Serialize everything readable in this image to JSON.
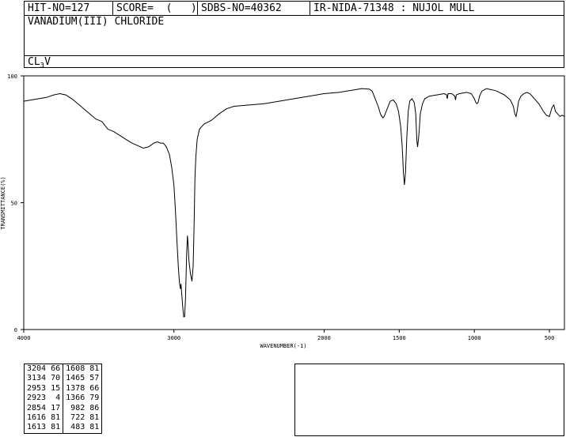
{
  "header": {
    "hit_no": "HIT-NO=127",
    "score": "SCORE=  (   )",
    "sdbs_no": "SDBS-NO=40362",
    "ir_nida": "IR-NIDA-71348 : NUJOL MULL"
  },
  "compound": {
    "name": "VANADIUM(III) CHLORIDE",
    "formula_prefix": "CL",
    "formula_sub": "3",
    "formula_suffix": "V"
  },
  "chart_data": {
    "type": "line",
    "xlabel": "WAVENUMBER(-1)",
    "ylabel": "TRANSMITTANCE(%)",
    "xlim": [
      4000,
      400
    ],
    "ylim": [
      0,
      100
    ],
    "x_ticks": [
      4000,
      3000,
      2000,
      1500,
      1000,
      500
    ],
    "y_ticks": [
      0,
      50,
      100
    ],
    "grid": false,
    "series": [
      {
        "color": "#000000",
        "points": [
          [
            4000,
            90
          ],
          [
            3950,
            90.5
          ],
          [
            3900,
            91
          ],
          [
            3850,
            91.5
          ],
          [
            3800,
            92.5
          ],
          [
            3760,
            93
          ],
          [
            3720,
            92.5
          ],
          [
            3680,
            91
          ],
          [
            3640,
            89
          ],
          [
            3600,
            87
          ],
          [
            3560,
            85
          ],
          [
            3520,
            83
          ],
          [
            3480,
            82
          ],
          [
            3440,
            79
          ],
          [
            3400,
            78
          ],
          [
            3360,
            76.5
          ],
          [
            3320,
            75
          ],
          [
            3280,
            73.5
          ],
          [
            3240,
            72.5
          ],
          [
            3204,
            71.5
          ],
          [
            3170,
            72
          ],
          [
            3134,
            73.5
          ],
          [
            3110,
            74
          ],
          [
            3090,
            73.5
          ],
          [
            3070,
            73.5
          ],
          [
            3050,
            72
          ],
          [
            3030,
            69
          ],
          [
            3015,
            64
          ],
          [
            3000,
            57
          ],
          [
            2990,
            47
          ],
          [
            2980,
            35
          ],
          [
            2970,
            24
          ],
          [
            2962,
            18
          ],
          [
            2957,
            16
          ],
          [
            2953,
            18
          ],
          [
            2948,
            14
          ],
          [
            2940,
            8
          ],
          [
            2935,
            5
          ],
          [
            2929,
            5
          ],
          [
            2923,
            12
          ],
          [
            2915,
            30
          ],
          [
            2910,
            37
          ],
          [
            2905,
            33
          ],
          [
            2900,
            27
          ],
          [
            2890,
            22
          ],
          [
            2880,
            19
          ],
          [
            2872,
            25
          ],
          [
            2866,
            40
          ],
          [
            2860,
            60
          ],
          [
            2854,
            68
          ],
          [
            2845,
            75
          ],
          [
            2830,
            79
          ],
          [
            2800,
            81
          ],
          [
            2750,
            82.5
          ],
          [
            2700,
            85
          ],
          [
            2650,
            87
          ],
          [
            2600,
            88
          ],
          [
            2500,
            88.5
          ],
          [
            2400,
            89
          ],
          [
            2300,
            90
          ],
          [
            2200,
            91
          ],
          [
            2100,
            92
          ],
          [
            2000,
            93
          ],
          [
            1900,
            93.5
          ],
          [
            1850,
            94
          ],
          [
            1800,
            94.5
          ],
          [
            1750,
            95
          ],
          [
            1700,
            94.8
          ],
          [
            1680,
            94
          ],
          [
            1660,
            91
          ],
          [
            1640,
            88
          ],
          [
            1625,
            85
          ],
          [
            1616,
            84
          ],
          [
            1608,
            83.5
          ],
          [
            1600,
            84
          ],
          [
            1580,
            87
          ],
          [
            1560,
            90
          ],
          [
            1540,
            90.5
          ],
          [
            1520,
            89
          ],
          [
            1505,
            86
          ],
          [
            1490,
            80
          ],
          [
            1480,
            72
          ],
          [
            1472,
            62
          ],
          [
            1465,
            57
          ],
          [
            1458,
            62
          ],
          [
            1450,
            75
          ],
          [
            1440,
            86
          ],
          [
            1430,
            90
          ],
          [
            1415,
            91
          ],
          [
            1400,
            89.5
          ],
          [
            1390,
            85
          ],
          [
            1383,
            75
          ],
          [
            1378,
            72
          ],
          [
            1372,
            75
          ],
          [
            1366,
            79
          ],
          [
            1360,
            85
          ],
          [
            1345,
            89
          ],
          [
            1330,
            91
          ],
          [
            1300,
            92
          ],
          [
            1250,
            92.5
          ],
          [
            1200,
            93
          ],
          [
            1185,
            92.5
          ],
          [
            1180,
            91
          ],
          [
            1175,
            93
          ],
          [
            1150,
            93
          ],
          [
            1130,
            92
          ],
          [
            1125,
            90.5
          ],
          [
            1120,
            92.5
          ],
          [
            1100,
            93
          ],
          [
            1050,
            93.5
          ],
          [
            1020,
            93
          ],
          [
            1000,
            91
          ],
          [
            990,
            89.5
          ],
          [
            982,
            89
          ],
          [
            975,
            89.5
          ],
          [
            965,
            92
          ],
          [
            950,
            94
          ],
          [
            920,
            95
          ],
          [
            880,
            94.5
          ],
          [
            850,
            94
          ],
          [
            800,
            92.5
          ],
          [
            760,
            90.5
          ],
          [
            740,
            88
          ],
          [
            730,
            85
          ],
          [
            722,
            84
          ],
          [
            715,
            86
          ],
          [
            705,
            90
          ],
          [
            690,
            92
          ],
          [
            670,
            93
          ],
          [
            650,
            93.5
          ],
          [
            630,
            93
          ],
          [
            600,
            91
          ],
          [
            570,
            89
          ],
          [
            540,
            86
          ],
          [
            520,
            84.5
          ],
          [
            500,
            84
          ],
          [
            490,
            86
          ],
          [
            483,
            87.5
          ],
          [
            470,
            88.5
          ],
          [
            460,
            86
          ],
          [
            445,
            85
          ],
          [
            430,
            84
          ],
          [
            415,
            84.5
          ],
          [
            400,
            84
          ]
        ]
      }
    ]
  },
  "peaks": [
    [
      [
        "3204",
        "66"
      ],
      [
        "1608",
        "81"
      ]
    ],
    [
      [
        "3134",
        "70"
      ],
      [
        "1465",
        "57"
      ]
    ],
    [
      [
        "2953",
        "15"
      ],
      [
        "1378",
        "66"
      ]
    ],
    [
      [
        "2923",
        "4"
      ],
      [
        "1366",
        "79"
      ]
    ],
    [
      [
        "2854",
        "17"
      ],
      [
        "982",
        "86"
      ]
    ],
    [
      [
        "1616",
        "81"
      ],
      [
        "722",
        "81"
      ]
    ],
    [
      [
        "1613",
        "81"
      ],
      [
        "483",
        "81"
      ]
    ]
  ]
}
